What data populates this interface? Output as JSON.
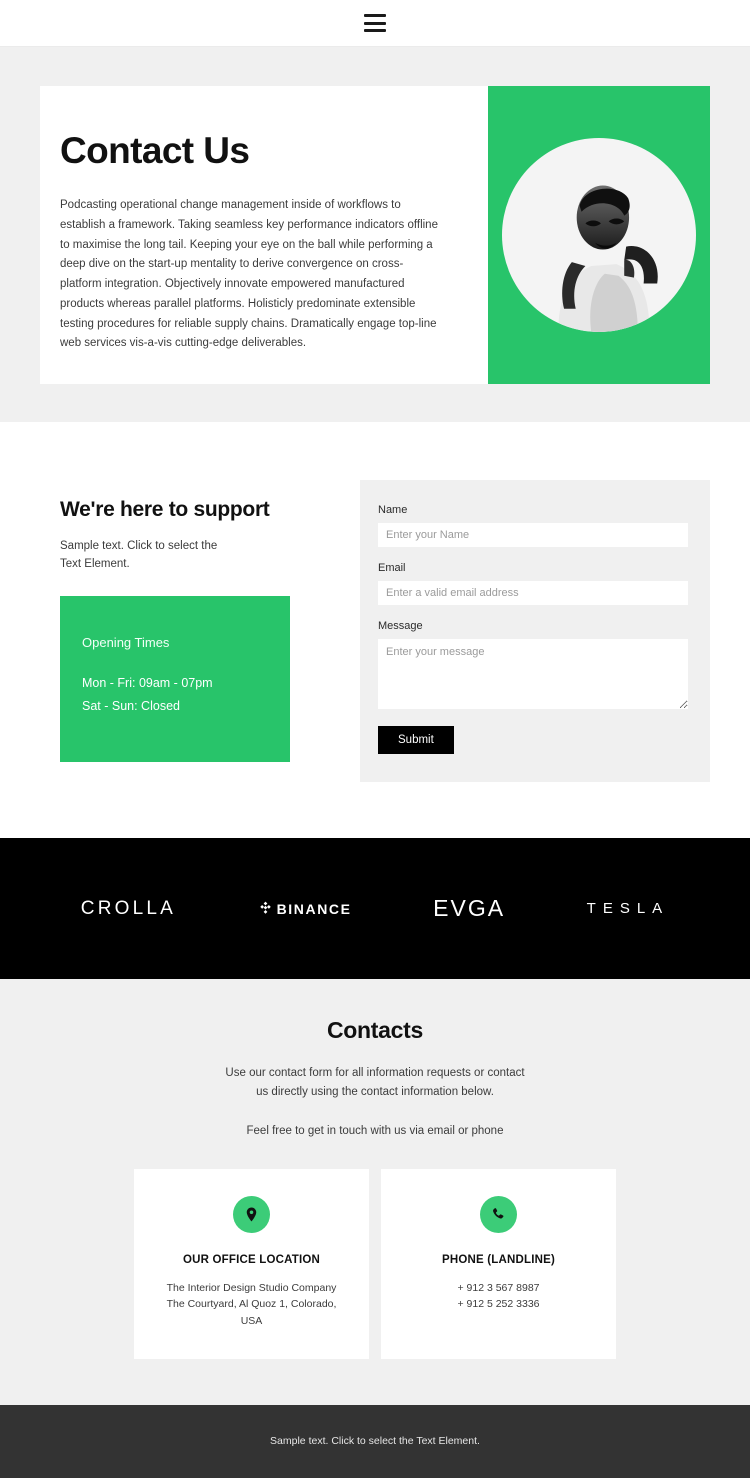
{
  "header": {
    "menu_icon": "hamburger-icon"
  },
  "hero": {
    "title": "Contact Us",
    "paragraph": "Podcasting operational change management inside of workflows to establish a framework. Taking seamless key performance indicators offline to maximise the long tail. Keeping your eye on the ball while performing a deep dive on the start-up mentality to derive convergence on cross-platform integration. Objectively innovate empowered manufactured products whereas parallel platforms. Holisticly predominate extensible testing procedures for reliable supply chains. Dramatically engage top-line web services vis-a-vis cutting-edge deliverables.",
    "image_alt": "portrait-photo"
  },
  "support": {
    "title": "We're here to support",
    "subtext": "Sample text. Click to select the Text Element.",
    "hours": {
      "title": "Opening Times",
      "weekday": "Mon - Fri: 09am - 07pm",
      "weekend": "Sat - Sun: Closed"
    }
  },
  "form": {
    "name_label": "Name",
    "name_placeholder": "Enter your Name",
    "email_label": "Email",
    "email_placeholder": "Enter a valid email address",
    "message_label": "Message",
    "message_placeholder": "Enter your message",
    "submit_label": "Submit"
  },
  "logos": [
    {
      "name": "CROLLA",
      "id": "logo-crolla"
    },
    {
      "name": "BINANCE",
      "id": "logo-binance"
    },
    {
      "name": "EVGA",
      "id": "logo-evga"
    },
    {
      "name": "TESLA",
      "id": "logo-tesla"
    }
  ],
  "contacts": {
    "title": "Contacts",
    "lead": "Use our contact form for all information requests or contact us directly using the contact information below.",
    "lead2": "Feel free to get in touch with us via email or phone",
    "cards": [
      {
        "icon": "map-pin-icon",
        "title": "OUR OFFICE LOCATION",
        "line1": "The Interior Design Studio Company",
        "line2": "The Courtyard, Al Quoz 1, Colorado,",
        "line3": "USA"
      },
      {
        "icon": "phone-icon",
        "title": "PHONE (LANDLINE)",
        "line1": "+ 912 3 567 8987",
        "line2": "+ 912 5 252 3336",
        "line3": ""
      }
    ]
  },
  "footer": {
    "text": "Sample text. Click to select the Text Element."
  },
  "colors": {
    "accent_green": "#28c46a",
    "icon_green": "#3ccc78",
    "page_gray": "#f0f0f0",
    "band_black": "#000000",
    "footer_gray": "#333333"
  }
}
